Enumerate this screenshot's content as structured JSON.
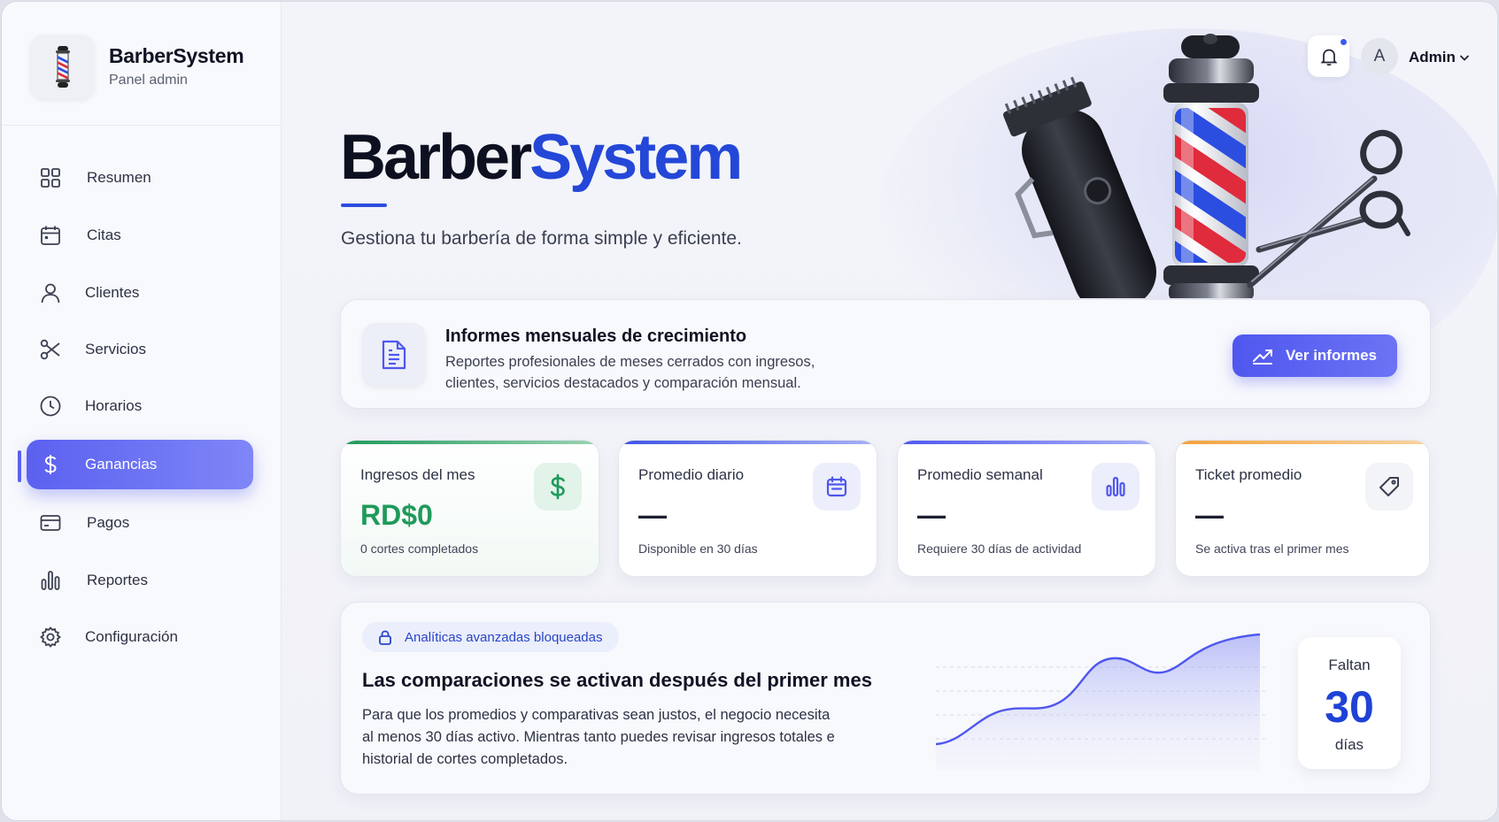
{
  "brand": {
    "name": "BarberSystem",
    "subtitle": "Panel admin"
  },
  "sidebar": {
    "items": [
      {
        "label": "Resumen",
        "icon": "grid-icon",
        "active": false
      },
      {
        "label": "Citas",
        "icon": "calendar-icon",
        "active": false
      },
      {
        "label": "Clientes",
        "icon": "user-icon",
        "active": false
      },
      {
        "label": "Servicios",
        "icon": "scissors-icon",
        "active": false
      },
      {
        "label": "Horarios",
        "icon": "clock-icon",
        "active": false
      },
      {
        "label": "Ganancias",
        "icon": "dollar-icon",
        "active": true
      },
      {
        "label": "Pagos",
        "icon": "credit-card-icon",
        "active": false
      },
      {
        "label": "Reportes",
        "icon": "bar-chart-icon",
        "active": false
      },
      {
        "label": "Configuración",
        "icon": "gear-icon",
        "active": false
      }
    ]
  },
  "header": {
    "user_initial": "A",
    "user_name": "Admin"
  },
  "hero": {
    "title_part1": "Barber",
    "title_part2": "System",
    "subtitle": "Gestiona tu barbería de forma simple y eficiente."
  },
  "report": {
    "title": "Informes mensuales de crecimiento",
    "description": "Reportes profesionales de meses cerrados con ingresos, clientes, servicios destacados y comparación mensual.",
    "button_label": "Ver informes"
  },
  "stats": [
    {
      "label": "Ingresos del mes",
      "value": "RD$0",
      "note": "0 cortes completados",
      "icon": "dollar-icon",
      "accent": "#1f9a5a"
    },
    {
      "label": "Promedio diario",
      "value": "—",
      "note": "Disponible en 30 días",
      "icon": "calendar-icon",
      "accent": "#4f57ef"
    },
    {
      "label": "Promedio semanal",
      "value": "—",
      "note": "Requiere 30 días de actividad",
      "icon": "bar-chart-icon",
      "accent": "#4f57ef"
    },
    {
      "label": "Ticket promedio",
      "value": "—",
      "note": "Se activa tras el primer mes",
      "icon": "tag-icon",
      "accent": "#f2a23c"
    }
  ],
  "analytics": {
    "badge": "Analíticas avanzadas bloqueadas",
    "title": "Las comparaciones se activan después del primer mes",
    "description": "Para que los promedios y comparativas sean justos, el negocio necesita al menos 30 días activo. Mientras tanto puedes revisar ingresos totales e historial de cortes completados.",
    "countdown_top": "Faltan",
    "countdown_value": "30",
    "countdown_bottom": "días"
  },
  "colors": {
    "accent": "#4f57ef",
    "brand_blue": "#2447d8",
    "green": "#1f9a5a",
    "orange": "#f2a23c"
  }
}
